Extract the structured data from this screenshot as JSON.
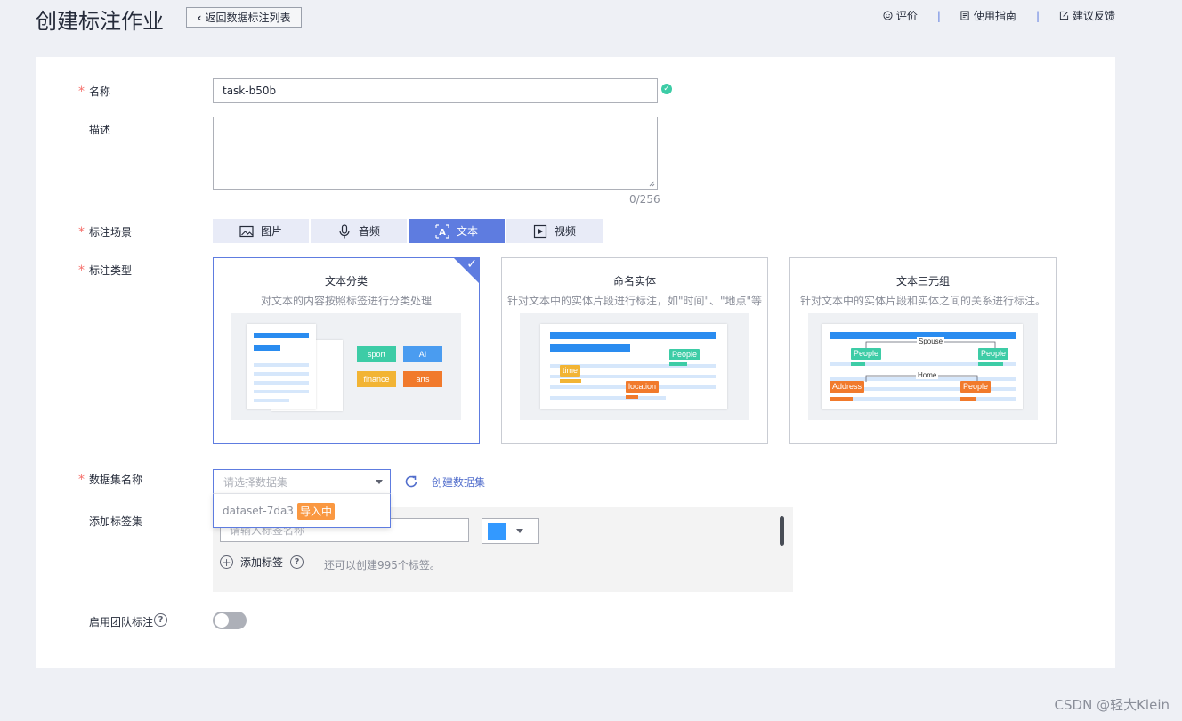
{
  "header": {
    "title": "创建标注作业",
    "back_label": "返回数据标注列表",
    "links": [
      {
        "label": "评价",
        "icon": "smile-icon"
      },
      {
        "label": "使用指南",
        "icon": "guide-icon"
      },
      {
        "label": "建议反馈",
        "icon": "feedback-icon"
      }
    ],
    "separator": "|"
  },
  "form": {
    "name": {
      "label": "名称",
      "value": "task-b50b",
      "valid": true
    },
    "description": {
      "label": "描述",
      "value": "",
      "counter": "0/256"
    },
    "scene": {
      "label": "标注场景",
      "options": [
        {
          "label": "图片",
          "icon": "image-icon"
        },
        {
          "label": "音频",
          "icon": "microphone-icon"
        },
        {
          "label": "文本",
          "icon": "text-icon"
        },
        {
          "label": "视频",
          "icon": "video-icon"
        }
      ],
      "selected": "文本"
    },
    "type": {
      "label": "标注类型",
      "cards": [
        {
          "title": "文本分类",
          "desc": "对文本的内容按照标签进行分类处理",
          "selected": true,
          "chips": [
            "sport",
            "AI",
            "finance",
            "arts"
          ]
        },
        {
          "title": "命名实体",
          "desc": "针对文本中的实体片段进行标注，如\"时间\"、\"地点\"等",
          "selected": false,
          "tags": [
            "People",
            "time",
            "location"
          ]
        },
        {
          "title": "文本三元组",
          "desc": "针对文本中的实体片段和实体之间的关系进行标注。",
          "selected": false,
          "tags": [
            "People",
            "People",
            "Address",
            "People"
          ],
          "relations": [
            "Spouse",
            "Home"
          ]
        }
      ]
    },
    "dataset": {
      "label": "数据集名称",
      "placeholder": "请选择数据集",
      "options": [
        {
          "name": "dataset-7da3",
          "badge": "导入中"
        }
      ],
      "create_label": "创建数据集"
    },
    "labels": {
      "label": "添加标签集",
      "input_placeholder": "请输入标签名称",
      "color": "#3399ff",
      "add_label": "添加标签",
      "hint": "还可以创建995个标签。"
    },
    "team": {
      "label": "启用团队标注",
      "enabled": false
    }
  },
  "watermark": "CSDN @轻大Klein"
}
